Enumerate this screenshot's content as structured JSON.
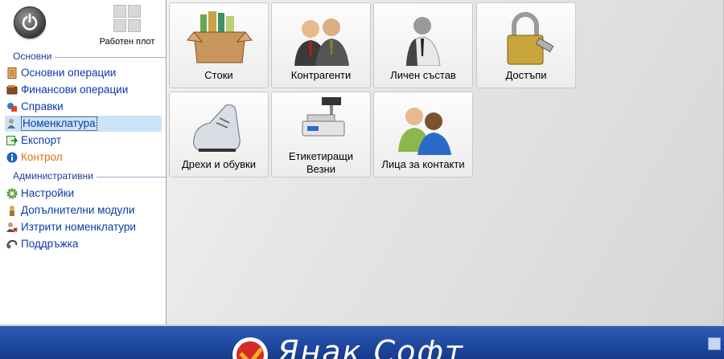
{
  "header": {
    "power_icon": "power-icon",
    "desktop_label": "Работен плот",
    "desktop_icon": "windows-icon"
  },
  "sidebar": {
    "main_section_title": "Основни",
    "main_items": [
      {
        "label": "Основни операции",
        "icon": "document-icon"
      },
      {
        "label": "Финансови операции",
        "icon": "wallet-icon"
      },
      {
        "label": "Справки",
        "icon": "report-icon"
      },
      {
        "label": "Номенклатура",
        "icon": "person-list-icon",
        "selected": true
      },
      {
        "label": "Експорт",
        "icon": "export-icon"
      },
      {
        "label": "Контрол",
        "icon": "info-icon",
        "color": "#e06d1b"
      }
    ],
    "admin_section_title": "Административни",
    "admin_items": [
      {
        "label": "Настройки",
        "icon": "settings-gear-icon"
      },
      {
        "label": "Допълнителни модули",
        "icon": "module-icon"
      },
      {
        "label": "Изтрити номенклатури",
        "icon": "deleted-users-icon"
      },
      {
        "label": "Поддръжка",
        "icon": "support-headset-icon"
      }
    ]
  },
  "tiles": [
    {
      "label": "Стоки",
      "icon": "goods-box-icon"
    },
    {
      "label": "Контрагенти",
      "icon": "business-people-icon"
    },
    {
      "label": "Личен състав",
      "icon": "employee-icon"
    },
    {
      "label": "Достъпи",
      "icon": "padlock-key-icon"
    },
    {
      "label": "Дрехи и обувки",
      "icon": "sneaker-icon"
    },
    {
      "label_line1": "Етикетиращи",
      "label_line2": "Везни",
      "icon": "label-scale-icon"
    },
    {
      "label": "Лица за контакти",
      "icon": "contacts-people-icon"
    }
  ],
  "footer": {
    "brand": "Янак Софт",
    "brand_color": "#1e47a0"
  },
  "colors": {
    "link": "#0b3aa8",
    "section": "#1f3d99",
    "selected_bg": "#cce4f7",
    "accent_orange": "#e06d1b"
  }
}
